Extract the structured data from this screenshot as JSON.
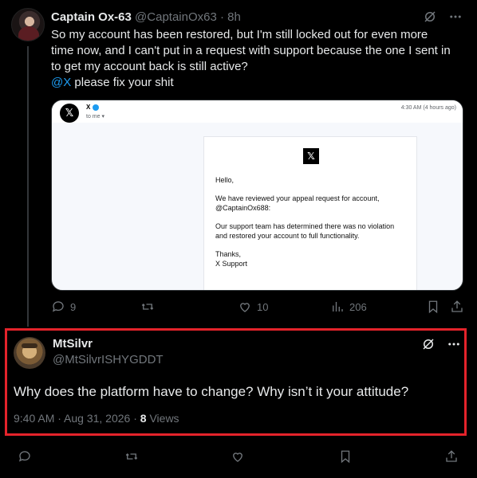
{
  "tweet": {
    "name": "Captain Ox-63",
    "handle": "@CaptainOx63 · 8h",
    "text_lines": [
      "So my account has been restored, but I'm still locked out for even more",
      "time now, and I can't put in a request with support because the one I sent in",
      "to get my account back is still active?"
    ],
    "mention": "@X",
    "mention_rest": " please fix your shit",
    "email": {
      "sender": "X",
      "to": "to me ▾",
      "time": "4:30 AM (4 hours ago)",
      "logo": "X",
      "greeting": "Hello,",
      "para1": "We have reviewed your appeal request for account, @CaptainOx688:",
      "para2": "Our support team has determined there was no violation and restored your account to full functionality.",
      "sign1": "Thanks,",
      "sign2": "X Support"
    },
    "replies": "9",
    "reposts": "",
    "likes": "10",
    "views": "206"
  },
  "reply": {
    "name": "MtSilvr",
    "handle": "@MtSilvrISHYGDDT",
    "text": "Why does the platform have to change? Why isn’t it your attitude?",
    "timestamp": "9:40 AM · Aug 31, 2026 · ",
    "views_count": "8",
    "views_label": " Views"
  },
  "icons": {
    "more": "more-icon",
    "grok": "grok-icon"
  },
  "colors": {
    "highlight": "#e4232b",
    "link": "#1d9bf0",
    "muted": "#71767b"
  }
}
